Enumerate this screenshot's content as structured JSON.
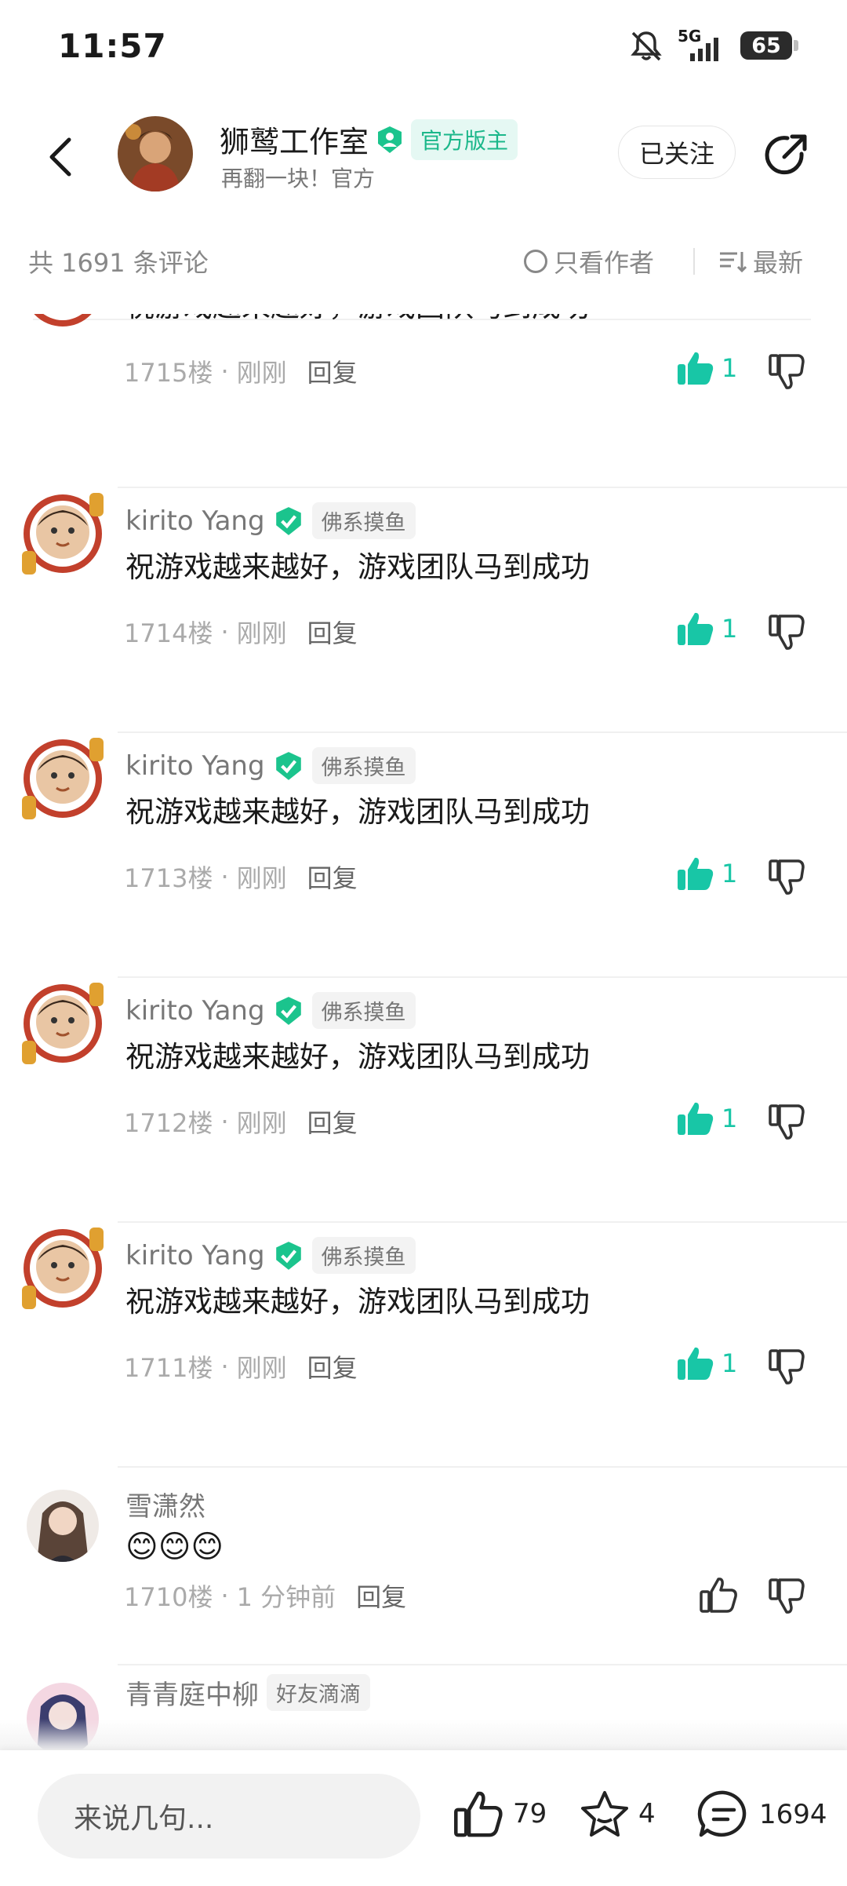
{
  "status_bar": {
    "time": "11:57",
    "network": "5G",
    "battery": "65"
  },
  "header": {
    "name": "狮鹫工作室",
    "badge": "官方版主",
    "subtitle": "再翻一块！官方",
    "follow_label": "已关注"
  },
  "filter_bar": {
    "count": "共 1691 条评论",
    "only_author": "只看作者",
    "sort": "最新"
  },
  "comments": [
    {
      "user": "",
      "tag": "",
      "text": "祝游戏越来越好，游戏团队马到成功",
      "floor": "1715楼",
      "time": "刚刚",
      "reply": "回复",
      "likes": "1"
    },
    {
      "user": "kirito Yang",
      "tag": "佛系摸鱼",
      "text": "祝游戏越来越好，游戏团队马到成功",
      "floor": "1714楼",
      "time": "刚刚",
      "reply": "回复",
      "likes": "1"
    },
    {
      "user": "kirito Yang",
      "tag": "佛系摸鱼",
      "text": "祝游戏越来越好，游戏团队马到成功",
      "floor": "1713楼",
      "time": "刚刚",
      "reply": "回复",
      "likes": "1"
    },
    {
      "user": "kirito Yang",
      "tag": "佛系摸鱼",
      "text": "祝游戏越来越好，游戏团队马到成功",
      "floor": "1712楼",
      "time": "刚刚",
      "reply": "回复",
      "likes": "1"
    },
    {
      "user": "kirito Yang",
      "tag": "佛系摸鱼",
      "text": "祝游戏越来越好，游戏团队马到成功",
      "floor": "1711楼",
      "time": "刚刚",
      "reply": "回复",
      "likes": "1"
    },
    {
      "user": "雪潇然",
      "tag": "",
      "text": "😊😊😊",
      "floor": "1710楼",
      "time": "1 分钟前",
      "reply": "回复",
      "likes": ""
    },
    {
      "user": "青青庭中柳",
      "tag": "好友滴滴",
      "text": "",
      "floor": "",
      "time": "",
      "reply": "",
      "likes": ""
    }
  ],
  "bottom_bar": {
    "input_placeholder": "来说几句...",
    "likes": "79",
    "favorites": "4",
    "comments": "1694"
  },
  "colors": {
    "accent": "#18c6a6",
    "official_tag": "#1bb78a"
  }
}
